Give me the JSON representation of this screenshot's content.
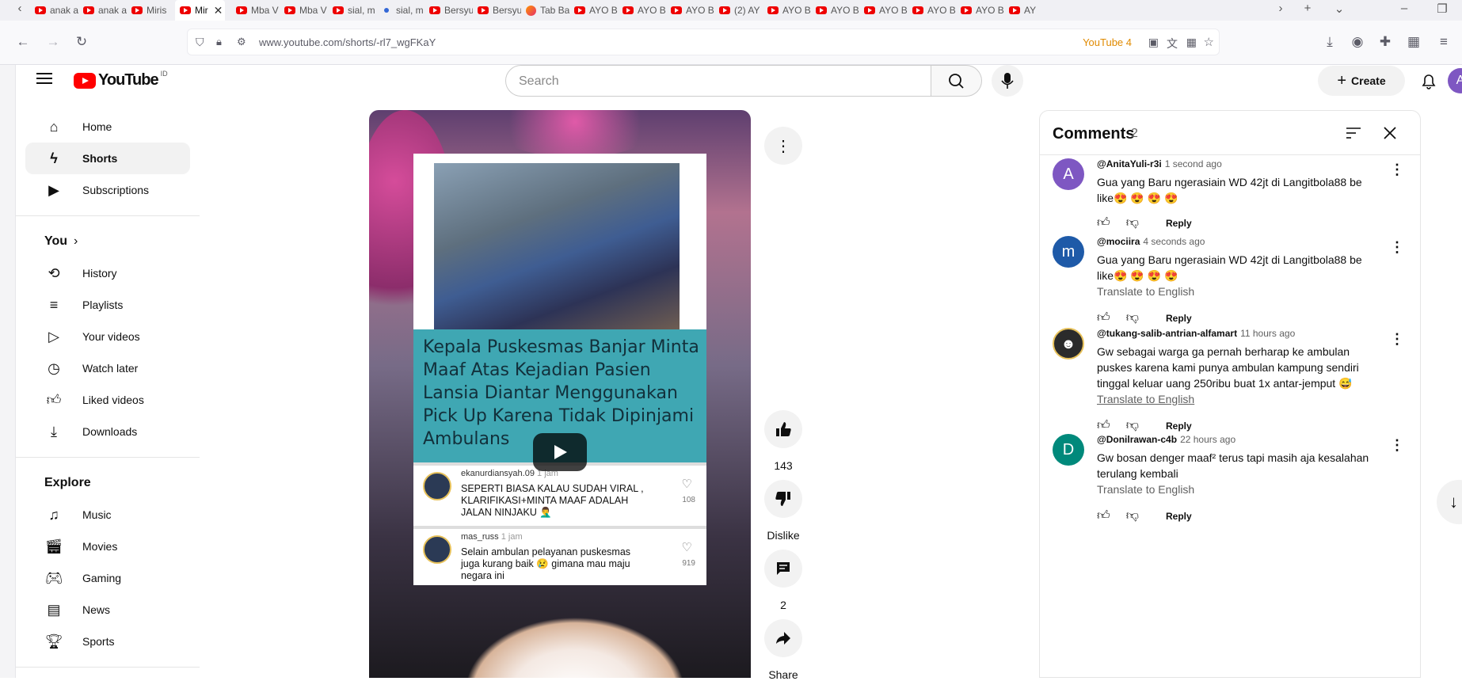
{
  "browser": {
    "tabs": [
      {
        "label": "anak a",
        "icon": "youtube-icon"
      },
      {
        "label": "anak a",
        "icon": "youtube-icon"
      },
      {
        "label": "Miris",
        "icon": "youtube-icon"
      },
      {
        "label": "Mir",
        "icon": "youtube-icon",
        "active": true
      },
      {
        "label": "Mba V",
        "icon": "youtube-icon"
      },
      {
        "label": "Mba V",
        "icon": "youtube-icon"
      },
      {
        "label": "sial, m",
        "icon": "youtube-icon"
      },
      {
        "label": "sial, m",
        "icon": "dot-icon"
      },
      {
        "label": "Bersyu",
        "icon": "youtube-icon"
      },
      {
        "label": "Bersyu",
        "icon": "youtube-icon"
      },
      {
        "label": "Tab Ba",
        "icon": "firefox-icon"
      },
      {
        "label": "AYO B",
        "icon": "youtube-icon"
      },
      {
        "label": "AYO B",
        "icon": "youtube-icon"
      },
      {
        "label": "AYO B",
        "icon": "youtube-icon"
      },
      {
        "label": "(2) AY",
        "icon": "youtube-icon"
      },
      {
        "label": "AYO B",
        "icon": "youtube-icon"
      },
      {
        "label": "AYO B",
        "icon": "youtube-icon"
      },
      {
        "label": "AYO B",
        "icon": "youtube-icon"
      },
      {
        "label": "AYO B",
        "icon": "youtube-icon"
      },
      {
        "label": "AYO B",
        "icon": "youtube-icon"
      },
      {
        "label": "AY",
        "icon": "youtube-icon"
      }
    ],
    "url": "www.youtube.com/shorts/-rl7_wgFKaY",
    "badge": "YouTube 4"
  },
  "youtube": {
    "logo_text": "YouTube",
    "logo_country": "ID",
    "search_placeholder": "Search",
    "create_label": "Create",
    "avatar_letter": "A"
  },
  "sidebar": {
    "main": [
      {
        "label": "Home",
        "icon": "home-icon"
      },
      {
        "label": "Shorts",
        "icon": "shorts-icon",
        "active": true
      },
      {
        "label": "Subscriptions",
        "icon": "subscriptions-icon"
      }
    ],
    "you_heading": "You",
    "you": [
      {
        "label": "History",
        "icon": "history-icon"
      },
      {
        "label": "Playlists",
        "icon": "playlists-icon"
      },
      {
        "label": "Your videos",
        "icon": "your-videos-icon"
      },
      {
        "label": "Watch later",
        "icon": "watch-later-icon"
      },
      {
        "label": "Liked videos",
        "icon": "liked-icon"
      },
      {
        "label": "Downloads",
        "icon": "download-icon"
      }
    ],
    "explore_heading": "Explore",
    "explore": [
      {
        "label": "Music",
        "icon": "music-icon"
      },
      {
        "label": "Movies",
        "icon": "movies-icon"
      },
      {
        "label": "Gaming",
        "icon": "gaming-icon"
      },
      {
        "label": "News",
        "icon": "news-icon"
      },
      {
        "label": "Sports",
        "icon": "sports-icon"
      }
    ]
  },
  "video": {
    "caption": "Kepala Puskesmas Banjar Minta Maaf Atas Kejadian Pasien Lansia Diantar Menggunakan Pick Up Karena Tidak Dipinjami Ambulans",
    "comments": [
      {
        "user": "ekanurdiansyah.09",
        "time": "1 jam",
        "text": "SEPERTI BIASA KALAU SUDAH VIRAL , KLARIFIKASI+MINTA MAAF ADALAH JALAN NINJAKU 🤦‍♂️",
        "likes": "108"
      },
      {
        "user": "mas_russ",
        "time": "1 jam",
        "text": "Selain ambulan pelayanan puskesmas juga kurang baik 😢 gimana mau maju negara ini",
        "likes": "919"
      }
    ]
  },
  "actions": {
    "like_count": "143",
    "dislike_label": "Dislike",
    "comment_count": "2",
    "share_label": "Share"
  },
  "comments_panel": {
    "title": "Comments",
    "count": "2",
    "items": [
      {
        "avatar": "A",
        "avatar_color": "#7e57c2",
        "user": "@AnitaYuli-r3i",
        "time": "1 second ago",
        "text": "Gua yang Baru ngerasiain WD 42jt di Langitbola88 be like😍 😍 😍 😍",
        "translate": "",
        "reply": "Reply"
      },
      {
        "avatar": "m",
        "avatar_color": "#1e5aa8",
        "user": "@mociira",
        "time": "4 seconds ago",
        "text": "Gua yang Baru ngerasiain WD 42jt di Langitbola88 be like😍 😍 😍 😍",
        "translate": "Translate to English",
        "reply": "Reply"
      },
      {
        "avatar": "",
        "avatar_color": "#2b2b2b",
        "user": "@tukang-salib-antrian-alfamart",
        "time": "11 hours ago",
        "text": "Gw sebagai warga ga pernah berharap ke ambulan puskes karena kami punya ambulan kampung sendiri tinggal keluar uang 250ribu buat 1x antar-jemput 😅",
        "translate": "Translate to English",
        "reply": "Reply"
      },
      {
        "avatar": "D",
        "avatar_color": "#00897b",
        "user": "@Donilrawan-c4b",
        "time": "22 hours ago",
        "text": "Gw bosan denger maaf² terus tapi masih aja kesalahan terulang kembali",
        "translate": "Translate to English",
        "reply": "Reply"
      }
    ]
  }
}
